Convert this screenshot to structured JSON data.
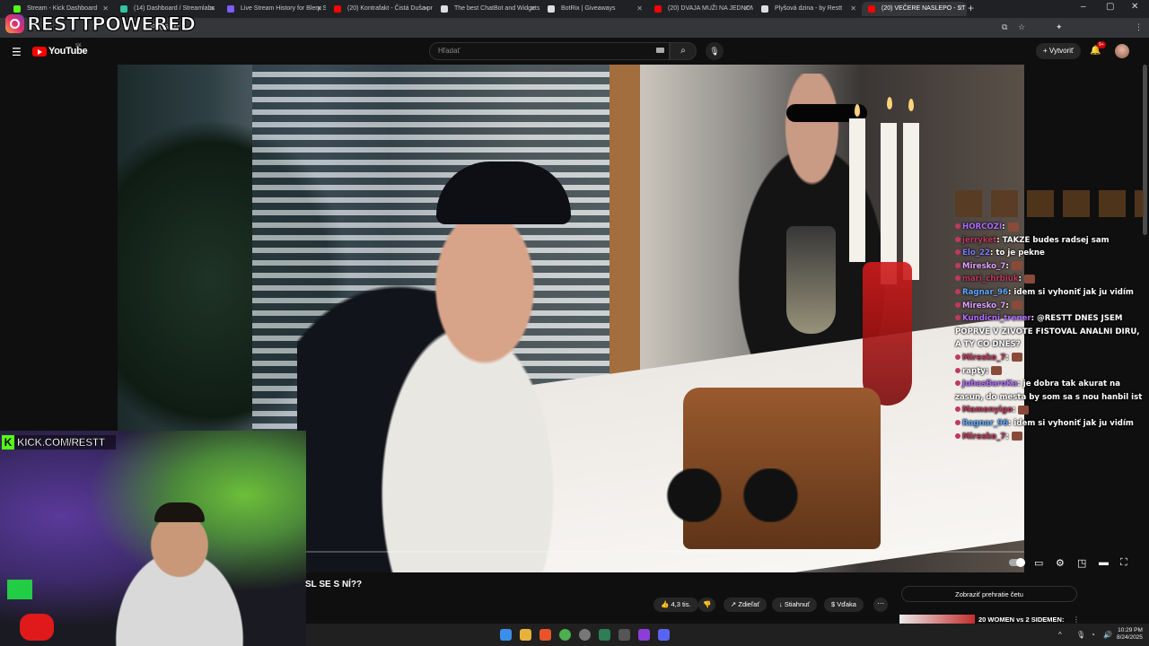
{
  "browser": {
    "tabs": [
      {
        "label": "Stream - Kick Dashboard",
        "color": "#53fc18"
      },
      {
        "label": "(14) Dashboard / Streamlabs",
        "color": "#31c3a2"
      },
      {
        "label": "Live Stream History for Blerp St",
        "color": "#7b5cff"
      },
      {
        "label": "(20) Kontrafakt - Čistá Duša pr",
        "color": "#ff0000"
      },
      {
        "label": "The best ChatBot and Widgets",
        "color": "#dddddd"
      },
      {
        "label": "BotRix | Giveaways",
        "color": "#dddddd"
      },
      {
        "label": "(20) DVAJA MUŽI NA JEDNOM",
        "color": "#ff0000"
      },
      {
        "label": "Plyšová dzina - by Restt",
        "color": "#dddddd"
      },
      {
        "label": "(20) VEČERE NASLEPO - ST",
        "color": "#ff0000"
      }
    ],
    "url_fragment": "PkC6RM",
    "overlay_brand": "RESTTPOWERED"
  },
  "youtube": {
    "logo_text": "YouTube",
    "country": "SK",
    "search_placeholder": "Hľadať",
    "create_label": "Vytvoriť",
    "notif_count": "9+",
    "video_title": "SL SE S NÍ??",
    "likes": "4,3 tis.",
    "share_label": "Zdieľať",
    "download_label": "Stiahnuť",
    "thanks_label": "Vďaka",
    "replay_chat_label": "Zobraziť prehratie četu",
    "recommended_title": "20 WOMEN vs 2 SIDEMEN:"
  },
  "chat": [
    {
      "user": "HORCOZI",
      "color": "#b06cff",
      "text": ""
    },
    {
      "user": "jerryket",
      "color": "#c0395f",
      "text": "TAKZE budes radsej sam"
    },
    {
      "user": "Elo_22",
      "color": "#7b7bff",
      "text": "to je pekne"
    },
    {
      "user": "Miresko_7",
      "color": "#e0a0ff",
      "text": ""
    },
    {
      "user": "mari_chrbiuk",
      "color": "#c0395f",
      "text": ""
    },
    {
      "user": "Ragnar_96",
      "color": "#5fa8ff",
      "text": "idem si vyhoniť jak ju vidím"
    },
    {
      "user": "Miresko_7",
      "color": "#e0a0ff",
      "text": ""
    },
    {
      "user": "Kundicni_trener",
      "color": "#b06cff",
      "text": "@RESTT DNES JSEM POPRVE V ZIVOTE FISTOVAL ANALNI DIRU, A TY CO DNES?"
    },
    {
      "user": "Miresko_7",
      "color": "#c0395f",
      "text": ""
    },
    {
      "user": "rapty",
      "color": "#ffffff",
      "text": ""
    },
    {
      "user": "JuhasBaroKa",
      "color": "#b06cff",
      "text": "je dobra tak akurat na zasun, do mesta by som sa s nou hanbil ist"
    },
    {
      "user": "Mamonyigo",
      "color": "#c0395f",
      "text": ""
    },
    {
      "user": "Ragnar_96",
      "color": "#5fa8ff",
      "text": "idem si vyhoniť jak ju vidím"
    },
    {
      "user": "Miresko_7",
      "color": "#c0395f",
      "text": ""
    }
  ],
  "webcam": {
    "kick_label": "KICK.COM/RESTT"
  },
  "taskbar": {
    "time": "10:29 PM",
    "date": "8/24/2025"
  }
}
